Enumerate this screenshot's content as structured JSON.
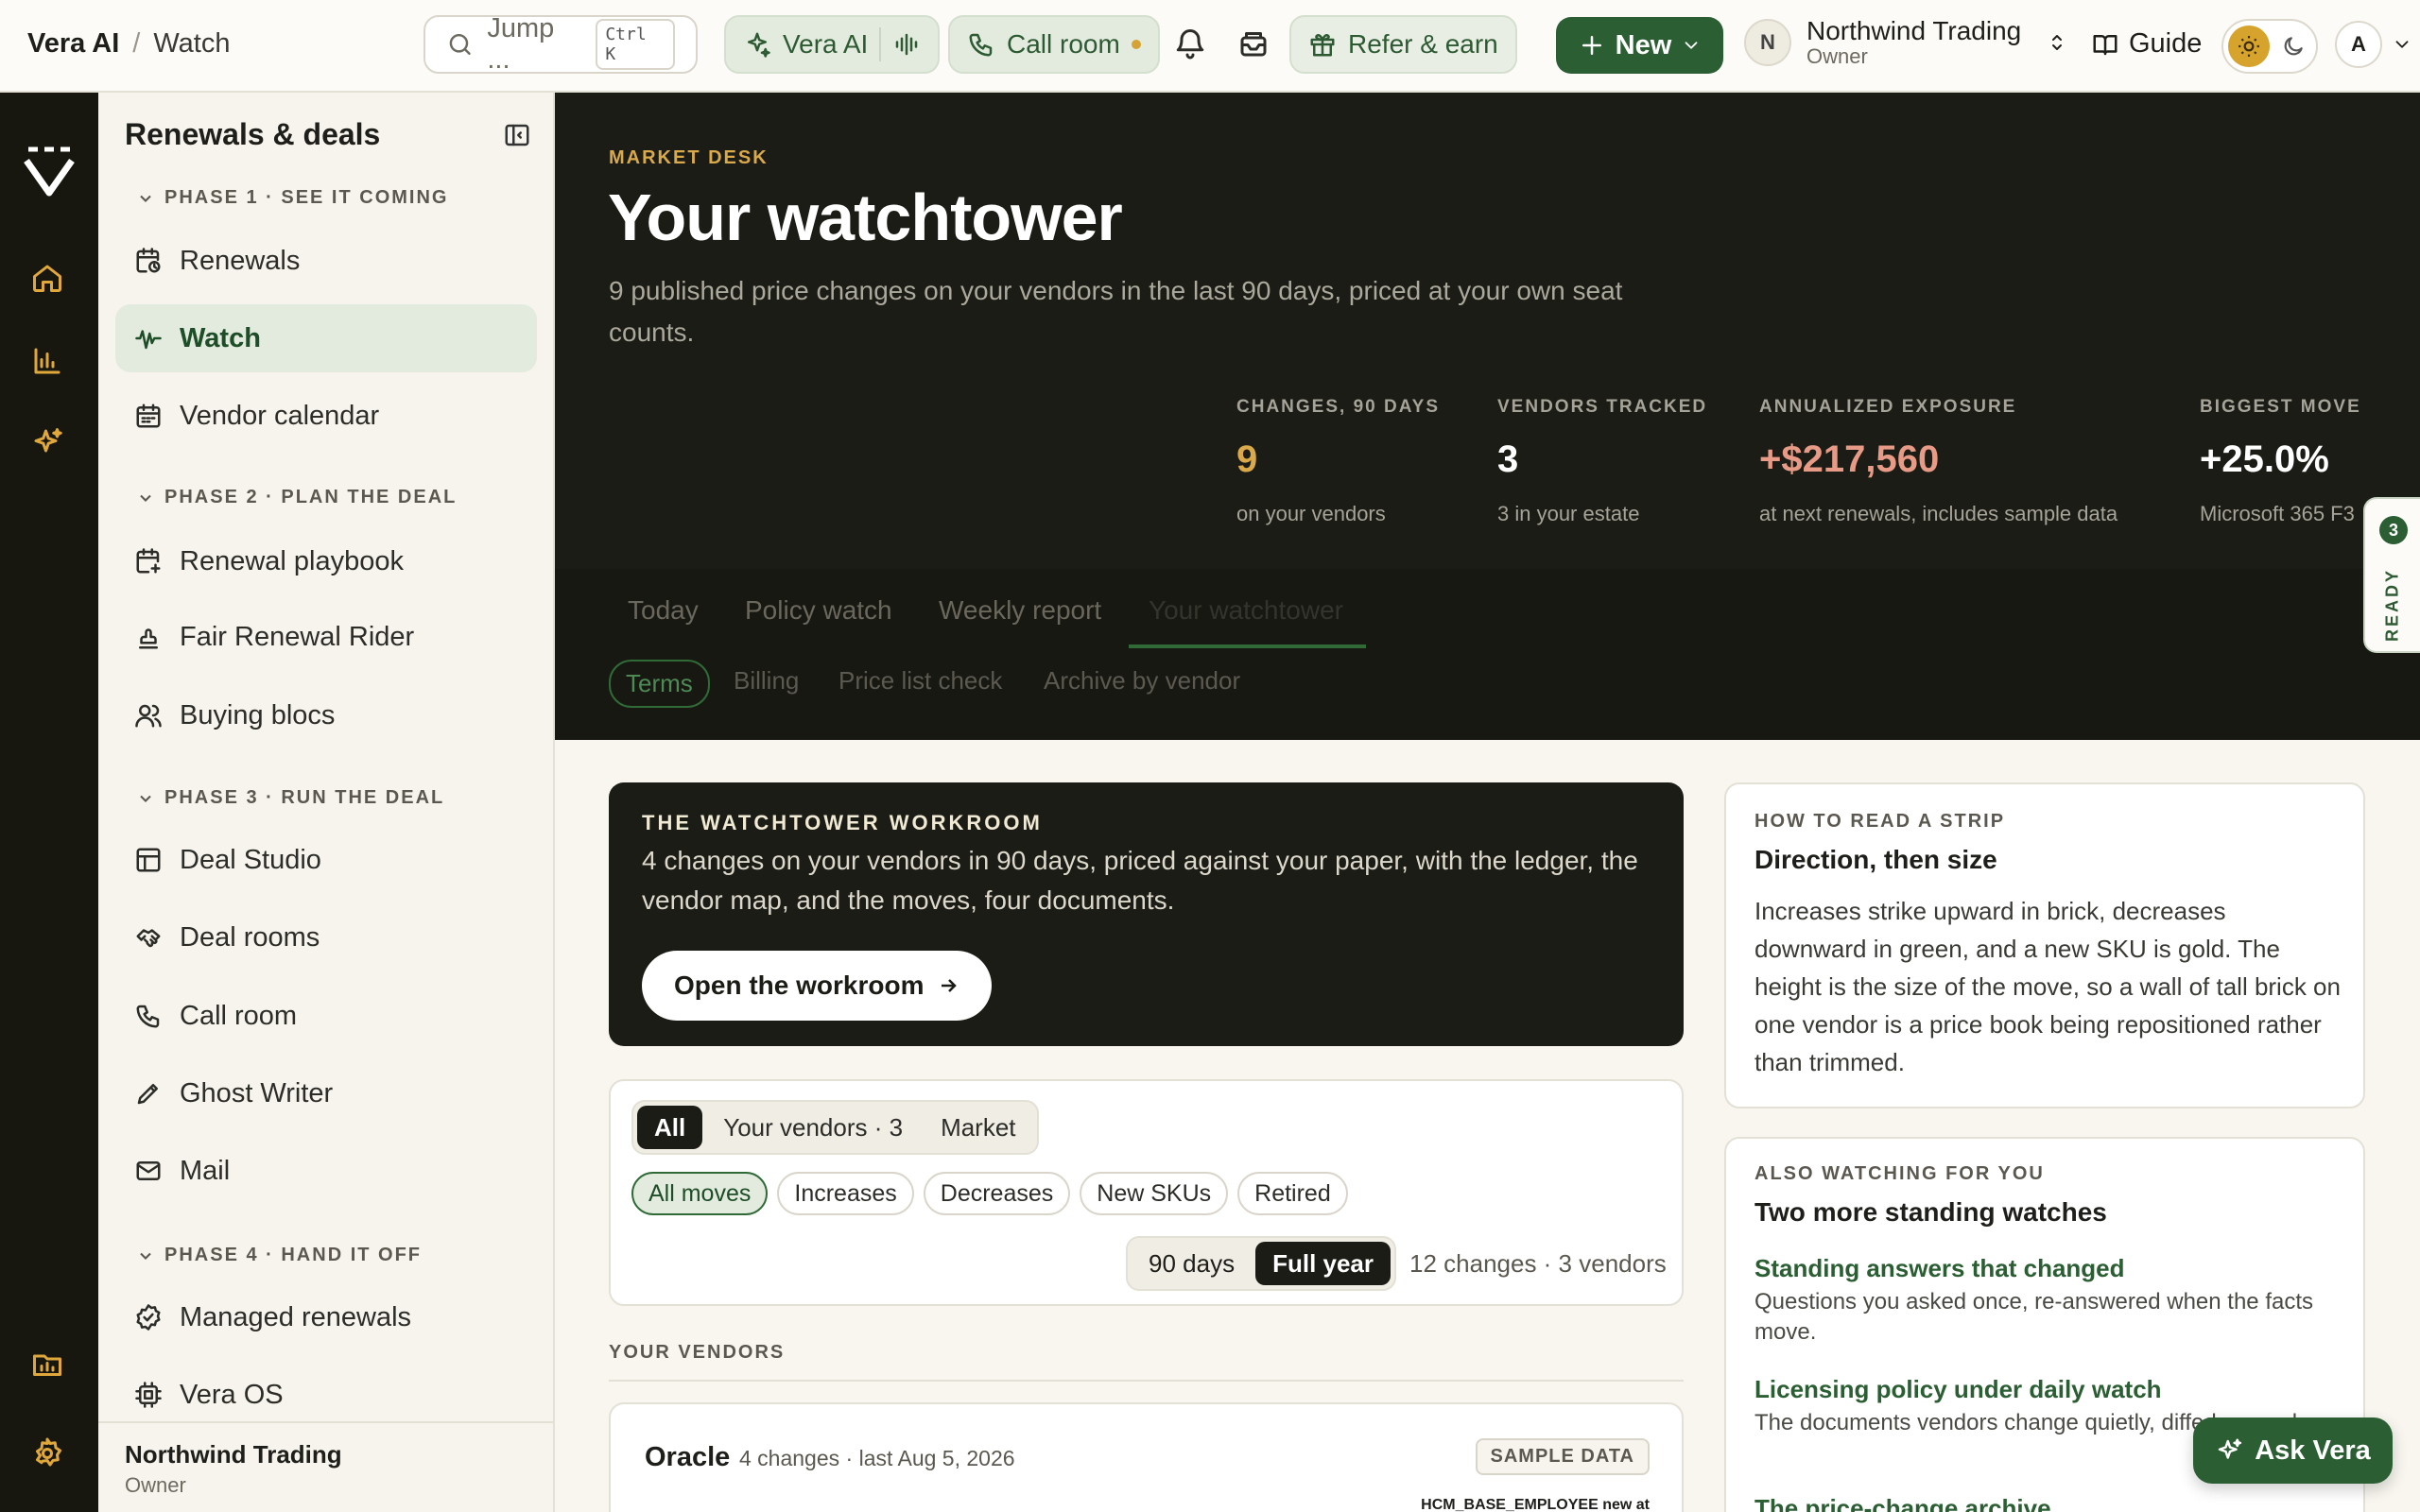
{
  "topbar": {
    "app": "Vera AI",
    "separator": "/",
    "page": "Watch",
    "search_placeholder": "Jump ...",
    "search_shortcut": "Ctrl K",
    "vera_label": "Vera AI",
    "callroom_label": "Call room",
    "refer_label": "Refer & earn",
    "new_label": "New",
    "org_initial": "N",
    "org_name": "Northwind Trading",
    "org_role": "Owner",
    "guide_label": "Guide",
    "user_initial": "A"
  },
  "sidebar": {
    "title": "Renewals & deals",
    "phases": [
      {
        "label": "PHASE 1 · SEE IT COMING",
        "items": [
          {
            "label": "Renewals",
            "icon": "calendar-clock-icon"
          },
          {
            "label": "Watch",
            "icon": "waveform-icon"
          },
          {
            "label": "Vendor calendar",
            "icon": "calendar-icon"
          }
        ]
      },
      {
        "label": "PHASE 2 · PLAN THE DEAL",
        "items": [
          {
            "label": "Renewal playbook",
            "icon": "calendar-plus-icon"
          },
          {
            "label": "Fair Renewal Rider",
            "icon": "stamp-icon"
          },
          {
            "label": "Buying blocs",
            "icon": "users-icon"
          }
        ]
      },
      {
        "label": "PHASE 3 · RUN THE DEAL",
        "items": [
          {
            "label": "Deal Studio",
            "icon": "layout-icon"
          },
          {
            "label": "Deal rooms",
            "icon": "handshake-icon"
          },
          {
            "label": "Call room",
            "icon": "phone-icon"
          },
          {
            "label": "Ghost Writer",
            "icon": "pen-icon"
          },
          {
            "label": "Mail",
            "icon": "mail-icon"
          }
        ]
      },
      {
        "label": "PHASE 4 · HAND IT OFF",
        "items": [
          {
            "label": "Managed renewals",
            "icon": "badge-check-icon"
          },
          {
            "label": "Vera OS",
            "icon": "cpu-icon"
          }
        ]
      }
    ],
    "active": "Watch",
    "footer_name": "Northwind Trading",
    "footer_role": "Owner"
  },
  "hero": {
    "eyebrow": "MARKET DESK",
    "title": "Your watchtower",
    "subtitle": "9 published price changes on your vendors in the last 90 days, priced at your own seat counts.",
    "stats": [
      {
        "label": "CHANGES, 90 DAYS",
        "value": "9",
        "sub": "on your vendors",
        "color": "#d9a94a"
      },
      {
        "label": "VENDORS TRACKED",
        "value": "3",
        "sub": "3 in your estate",
        "color": "#ffffff"
      },
      {
        "label": "ANNUALIZED EXPOSURE",
        "value": "+$217,560",
        "sub": "at next renewals, includes sample data",
        "color": "#e79a86"
      },
      {
        "label": "BIGGEST MOVE",
        "value": "+25.0%",
        "sub": "Microsoft 365 F3",
        "color": "#ffffff"
      }
    ],
    "tabs": [
      "Today",
      "Policy watch",
      "Weekly report",
      "Your watchtower"
    ],
    "subtabs": [
      "Terms",
      "Billing",
      "Price list check",
      "Archive by vendor"
    ],
    "ready_count": "3",
    "ready_label": "READY"
  },
  "workroom": {
    "eyebrow": "THE WATCHTOWER WORKROOM",
    "text": "4 changes on your vendors in 90 days, priced against your paper, with the ledger, the vendor map, and the moves, four documents.",
    "button": "Open the workroom"
  },
  "filters": {
    "scope": [
      "All",
      "Your vendors · 3",
      "Market"
    ],
    "moves": [
      "All moves",
      "Increases",
      "Decreases",
      "New SKUs",
      "Retired"
    ],
    "range": [
      "90 days",
      "Full year"
    ],
    "count": "12 changes · 3 vendors"
  },
  "vendors_section": "YOUR VENDORS",
  "vendor": {
    "name": "Oracle",
    "meta": "4 changes · last Aug 5, 2026",
    "tag": "SAMPLE DATA",
    "mini": "HCM_BASE_EMPLOYEE new at"
  },
  "howto": {
    "eyebrow": "HOW TO READ A STRIP",
    "title": "Direction, then size",
    "text": "Increases strike upward in brick, decreases downward in green, and a new SKU is gold. The height is the size of the move, so a wall of tall brick on one vendor is a price book being repositioned rather than trimmed."
  },
  "also": {
    "eyebrow": "ALSO WATCHING FOR YOU",
    "title": "Two more standing watches",
    "items": [
      {
        "title": "Standing answers that changed",
        "desc": "Questions you asked once, re-answered when the facts move."
      },
      {
        "title": "Licensing policy under daily watch",
        "desc": "The documents vendors change quietly, diffed every day."
      },
      {
        "title": "The price-change archive",
        "desc": ""
      }
    ]
  },
  "ask_vera": "Ask Vera"
}
